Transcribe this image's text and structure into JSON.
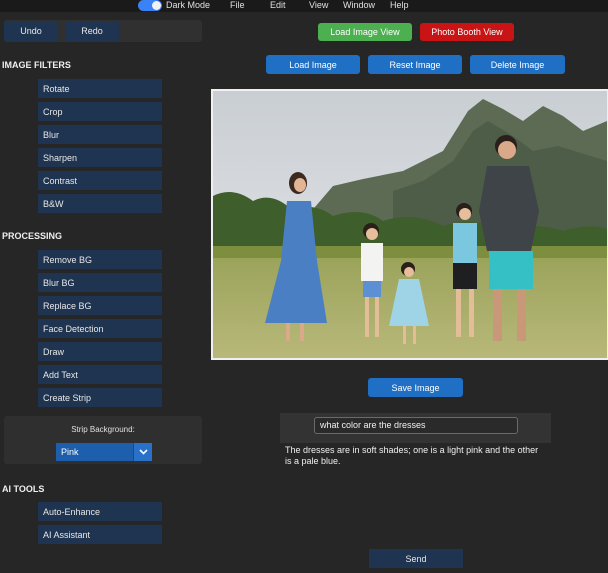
{
  "topbar": {
    "dark_mode_label": "Dark Mode",
    "menu": [
      "File",
      "Edit",
      "View",
      "Window",
      "Help"
    ]
  },
  "sidebar": {
    "undo": "Undo",
    "redo": "Redo",
    "image_filters_title": "IMAGE FILTERS",
    "filters": [
      "Rotate",
      "Crop",
      "Blur",
      "Sharpen",
      "Contrast",
      "B&W"
    ],
    "processing_title": "PROCESSING",
    "processing": [
      "Remove BG",
      "Blur BG",
      "Replace BG",
      "Face Detection",
      "Draw",
      "Add Text",
      "Create Strip"
    ],
    "strip_background_label": "Strip Background:",
    "strip_background_value": "Pink",
    "ai_tools_title": "AI TOOLS",
    "ai_tools": [
      "Auto-Enhance",
      "AI Assistant"
    ]
  },
  "main": {
    "load_image_view": "Load Image View",
    "photo_booth_view": "Photo Booth View",
    "load_image": "Load Image",
    "reset_image": "Reset Image",
    "delete_image": "Delete Image",
    "save_image": "Save Image",
    "query": "what color are the dresses",
    "answer": "The dresses are in soft shades; one is a light pink and the other is a pale blue.",
    "send": "Send"
  },
  "colors": {
    "accent": "#1f6fc4",
    "green": "#4caf50",
    "red": "#c81414",
    "dark_button": "#1f3450"
  }
}
